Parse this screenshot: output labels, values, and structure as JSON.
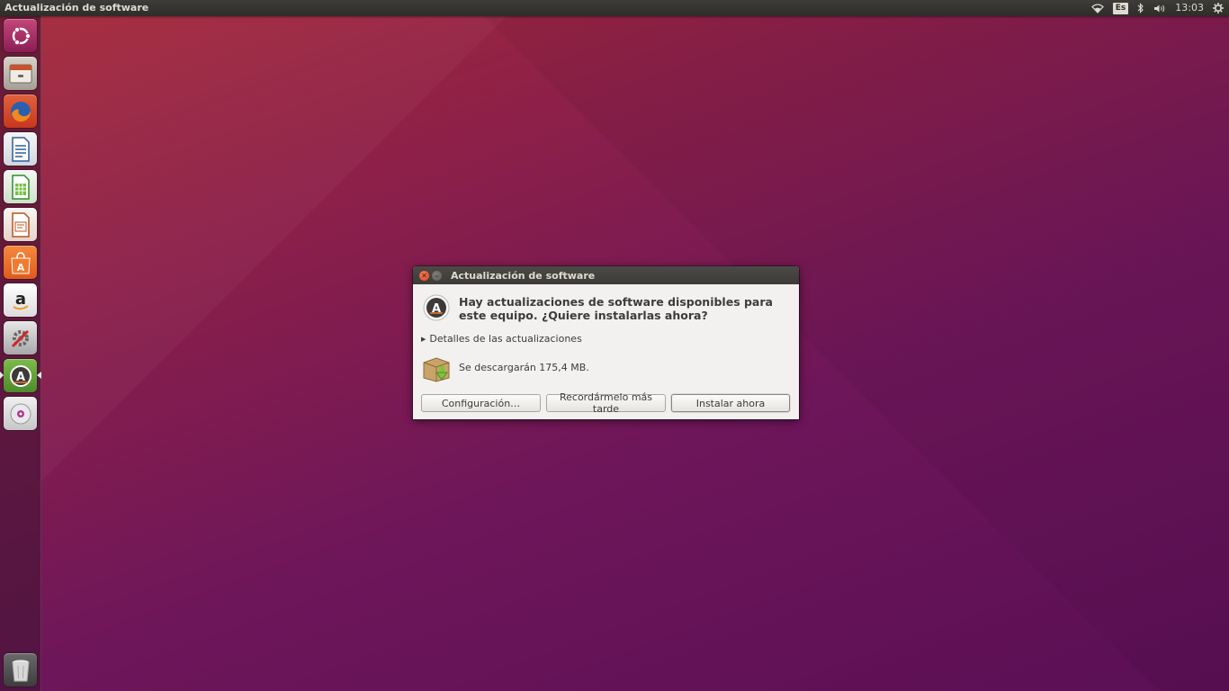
{
  "top_panel": {
    "window_title": "Actualización de software",
    "keyboard_layout": "Es",
    "clock": "13:03",
    "icons": [
      "wifi-icon",
      "bluetooth-icon",
      "volume-icon",
      "gear-icon"
    ]
  },
  "launcher": {
    "items": [
      {
        "name": "ubuntu-dash-icon"
      },
      {
        "name": "files-icon"
      },
      {
        "name": "firefox-icon"
      },
      {
        "name": "libreoffice-writer-icon"
      },
      {
        "name": "libreoffice-calc-icon"
      },
      {
        "name": "libreoffice-impress-icon"
      },
      {
        "name": "software-center-icon"
      },
      {
        "name": "amazon-icon"
      },
      {
        "name": "system-settings-icon"
      },
      {
        "name": "software-updater-icon",
        "active": true
      },
      {
        "name": "dvd-icon"
      },
      {
        "name": "trash-icon"
      }
    ],
    "colors": {
      "active": "#e9e9e9"
    }
  },
  "dialog": {
    "title": "Actualización de software",
    "headline": "Hay actualizaciones de software disponibles para este equipo. ¿Quiere instalarlas ahora?",
    "details_label": "Detalles de las actualizaciones",
    "download_text": "Se descargarán 175,4 MB.",
    "buttons": {
      "settings": "Configuración…",
      "remind_later": "Recordármelo más tarde",
      "install_now": "Instalar ahora"
    },
    "icons": [
      "close-icon",
      "minimize-icon",
      "software-updater-icon",
      "package-download-icon",
      "expander-arrow-icon"
    ]
  },
  "colors": {
    "panel": "#3c3b37",
    "close_button": "#df4a16",
    "dialog_bg": "#f2f1f0",
    "text": "#3c3c3c"
  }
}
